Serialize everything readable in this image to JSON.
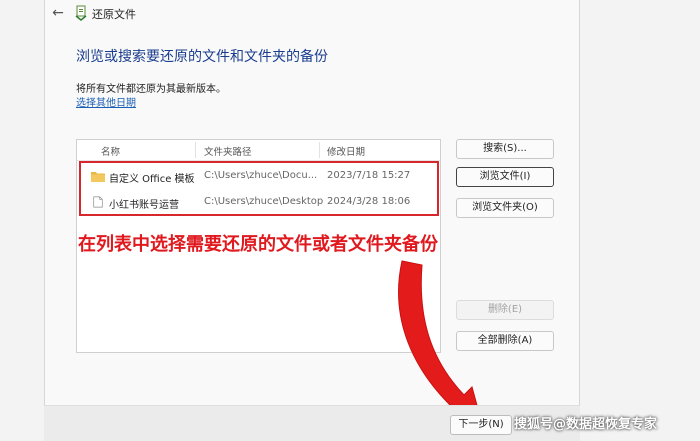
{
  "window": {
    "title": "还原文件",
    "back_icon": "back-arrow-icon",
    "title_icon": "file-history-icon"
  },
  "main": {
    "heading": "浏览或搜索要还原的文件和文件夹的备份",
    "description": "将所有文件都还原为其最新版本。",
    "other_date_link": "选择其他日期"
  },
  "list": {
    "columns": [
      "名称",
      "文件夹路径",
      "修改日期"
    ],
    "rows": [
      {
        "name": "自定义 Office 模板",
        "path": "C:\\Users\\zhuce\\Docu...",
        "date": "2023/7/18 15:27",
        "icon": "folder-icon"
      },
      {
        "name": "小红书账号运营",
        "path": "C:\\Users\\zhuce\\Desktop",
        "date": "2024/3/28 18:06",
        "icon": "file-icon"
      }
    ]
  },
  "buttons": {
    "search": "搜索(S)...",
    "browse_files": "浏览文件(I)",
    "browse_folders": "浏览文件夹(O)",
    "remove": "删除(E)",
    "remove_all": "全部删除(A)",
    "next": "下一步(N)"
  },
  "annotation": {
    "text": "在列表中选择需要还原的文件或者文件夹备份",
    "color": "#e0191f"
  },
  "watermark": "搜狐号@数据超恢复专家",
  "colors": {
    "heading": "#1a3d8f",
    "link": "#1a5fb4",
    "highlight": "#d7272d"
  }
}
